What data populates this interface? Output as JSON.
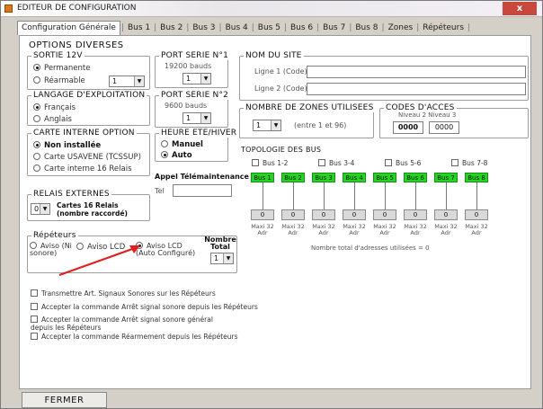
{
  "window": {
    "title": "EDITEUR DE CONFIGURATION",
    "close_label": "x"
  },
  "tabs": [
    {
      "label": "Configuration Générale"
    },
    {
      "label": "Bus 1"
    },
    {
      "label": "Bus 2"
    },
    {
      "label": "Bus 3"
    },
    {
      "label": "Bus 4"
    },
    {
      "label": "Bus 5"
    },
    {
      "label": "Bus 6"
    },
    {
      "label": "Bus 7"
    },
    {
      "label": "Bus 8"
    },
    {
      "label": "Zones"
    },
    {
      "label": "Répéteurs"
    }
  ],
  "options_title": "OPTIONS DIVERSES",
  "sortie": {
    "label": "SORTIE 12V",
    "opt1": "Permanente",
    "opt2": "Réarmable",
    "value": "1"
  },
  "langage": {
    "label": "LANGAGE D'EXPLOITATION",
    "opt1": "Français",
    "opt2": "Anglais"
  },
  "carte": {
    "label": "CARTE INTERNE OPTION",
    "opt1": "Non installée",
    "opt2": "Carte USAVENE (TCSSUP)",
    "opt3": "Carte interne 16 Relais"
  },
  "relais": {
    "label": "RELAIS EXTERNES",
    "value": "0",
    "desc": "Cartes 16 Relais (nombre raccordé)"
  },
  "port1": {
    "label": "PORT SERIE N°1",
    "sub": "19200 bauds",
    "value": "1"
  },
  "port2": {
    "label": "PORT SERIE N°2",
    "sub": "9600 bauds",
    "value": "1"
  },
  "heure": {
    "label": "HEURE ETE/HIVER",
    "opt1": "Manuel",
    "opt2": "Auto"
  },
  "appel": {
    "label": "Appel Télémaintenance",
    "tel_label": "Tel"
  },
  "repeteurs": {
    "label": "Répéteurs",
    "opt1": "Aviso (Ni sonore)",
    "opt2": "Aviso LCD",
    "opt3": "Aviso LCD (Auto Configuré)",
    "nombre_label": "Nombre Total",
    "nombre_value": "1"
  },
  "checks": [
    "Transmettre Art. Signaux Sonores sur les Répéteurs",
    "Accepter la commande Arrêt signal sonore depuis les Répéteurs",
    "Accepter la commande Arrêt signal sonore général depuis les Répéteurs",
    "Accepter la commande Réarmement depuis les Répéteurs"
  ],
  "site": {
    "label": "NOM DU SITE",
    "line1_label": "Ligne 1 (Code)",
    "line2_label": "Ligne 2 (Code)",
    "line1_value": "",
    "line2_value": ""
  },
  "zones": {
    "label": "NOMBRE DE ZONES UTILISEES",
    "value": "1",
    "desc": "(entre 1 et 96)"
  },
  "codes": {
    "label": "CODES D'ACCES",
    "sub": "Niveau 2   Niveau 3",
    "code1": "0000",
    "code2": "0000"
  },
  "topologie": {
    "label": "TOPOLOGIE DES BUS",
    "checks": [
      "Bus 1-2",
      "Bus 3-4",
      "Bus 5-6",
      "Bus 7-8"
    ],
    "buses": [
      {
        "name": "Bus 1",
        "value": "0",
        "sub": "Maxi 32 Adr"
      },
      {
        "name": "Bus 2",
        "value": "0",
        "sub": "Maxi 32 Adr"
      },
      {
        "name": "Bus 3",
        "value": "0",
        "sub": "Maxi 32 Adr"
      },
      {
        "name": "Bus 4",
        "value": "0",
        "sub": "Maxi 32 Adr"
      },
      {
        "name": "Bus 5",
        "value": "0",
        "sub": "Maxi 32 Adr"
      },
      {
        "name": "Bus 6",
        "value": "0",
        "sub": "Maxi 32 Adr"
      },
      {
        "name": "Bus 7",
        "value": "0",
        "sub": "Maxi 32 Adr"
      },
      {
        "name": "Bus 8",
        "value": "0",
        "sub": "Maxi 32 Adr"
      }
    ],
    "footnote": "Nombre total d'adresses utilisées = 0"
  },
  "footer": {
    "close_button": "FERMER"
  },
  "colors": {
    "bus_active": "#22d61f",
    "arrow": "#e02020",
    "close_button": "#c9483c"
  }
}
